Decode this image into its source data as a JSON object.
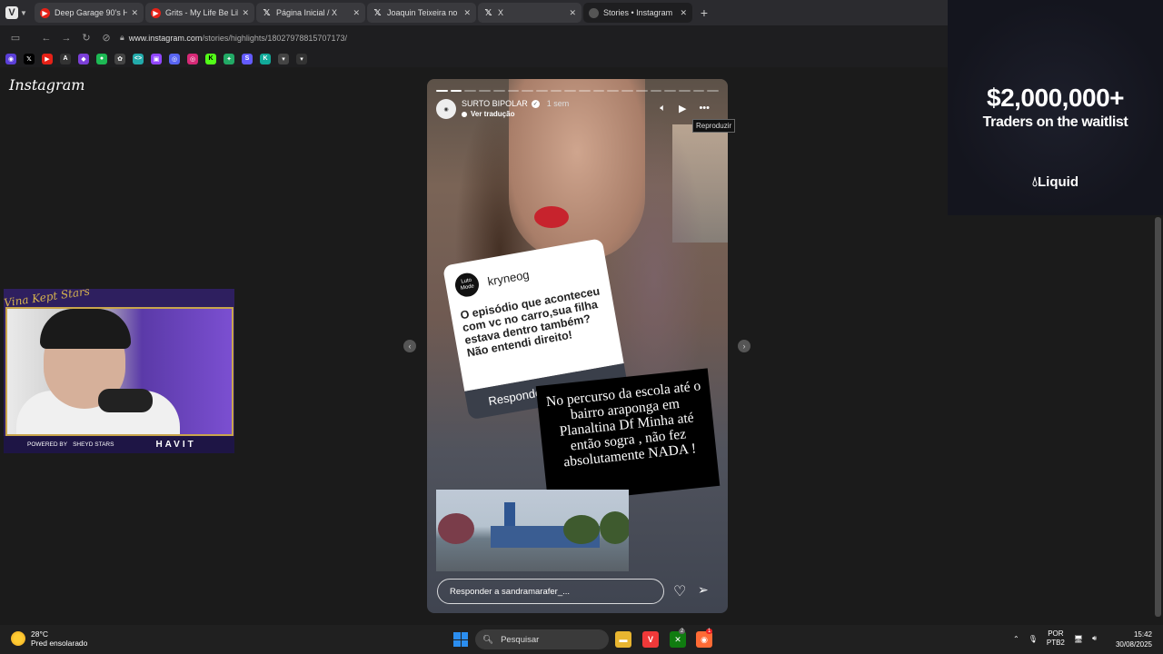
{
  "browser": {
    "tabs": [
      {
        "label": "Deep Garage 90's House",
        "icon": "youtube-icon"
      },
      {
        "label": "Grits - My Life Be Like",
        "icon": "youtube-icon"
      },
      {
        "label": "Página Inicial / X",
        "icon": "x-icon"
      },
      {
        "label": "Joaquin Teixeira no X:",
        "icon": "x-icon"
      },
      {
        "label": "X",
        "icon": "x-icon"
      },
      {
        "label": "Stories • Instagram",
        "icon": "instagram-icon",
        "active": true
      }
    ],
    "new_tab": "+",
    "address": {
      "host": "www.instagram.com",
      "path": "/stories/highlights/18027978815707173/"
    }
  },
  "instagram": {
    "logo": "Instagram",
    "story": {
      "username": "SURTO BIPOLAR",
      "age": "1 sem",
      "translate": "Ver tradução",
      "tooltip": "Reproduzir",
      "question": {
        "user": "kryneog",
        "avatar_text": "Luto Mode",
        "text": "O episódio que aconteceu com vc no carro,sua filha estava dentro também? Não entendi direito!",
        "reply": "Responder"
      },
      "caption": "No percurso da escola até o bairro araponga em Planaltina Df Minha até então sogra , não fez absolutamente NADA !",
      "reply_placeholder": "Responder a sandramarafer_..."
    }
  },
  "ad": {
    "amount": "$2,000,000+",
    "subtitle": "Traders on the waitlist",
    "brand": "Liquid"
  },
  "webcam": {
    "signature": "Vina Kept Stars",
    "powered_by": "POWERED BY",
    "sponsor1": "SHEYD STARS",
    "sponsor2": "HAVIT"
  },
  "taskbar": {
    "weather_temp": "28°C",
    "weather_desc": "Pred ensolarado",
    "search": "Pesquisar",
    "lang_top": "POR",
    "lang_bottom": "PTB2",
    "time": "15:42",
    "date": "30/08/2025",
    "badge_count_1": "2",
    "badge_count_2": "1"
  }
}
